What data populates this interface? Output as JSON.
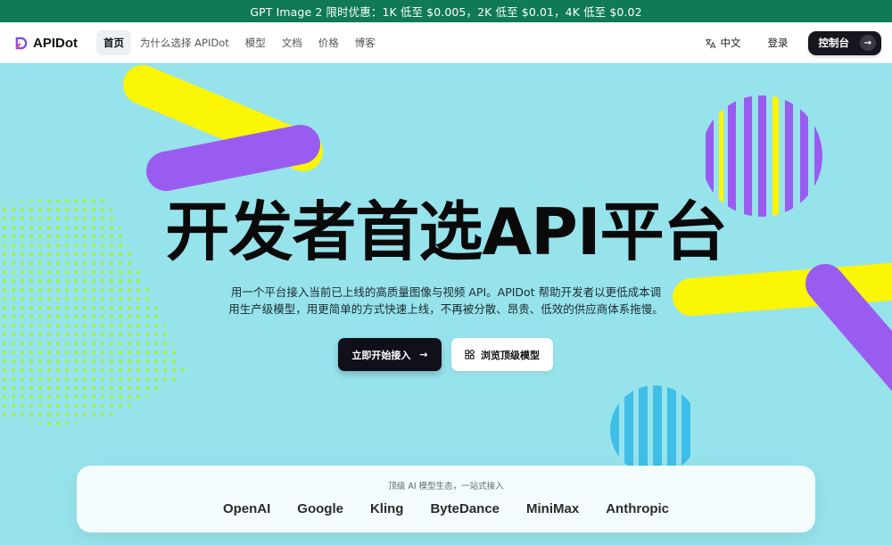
{
  "promo": {
    "text": "GPT Image 2 限时优惠：1K 低至 $0.005，2K 低至 $0.01，4K 低至 $0.02"
  },
  "nav": {
    "logo": "APIDot",
    "links": [
      "首页",
      "为什么选择 APIDot",
      "模型",
      "文档",
      "价格",
      "博客"
    ],
    "language": "中文",
    "login": "登录",
    "console": "控制台"
  },
  "hero": {
    "title": "开发者首选API平台",
    "desc_line1": "用一个平台接入当前已上线的高质量图像与视频 API。APIDot 帮助开发者以更低成本调",
    "desc_line2": "用生产级模型，用更简单的方式快速上线，不再被分散、昂贵、低效的供应商体系拖慢。",
    "primary_button": "立即开始接入",
    "secondary_button": "浏览顶级模型"
  },
  "partners": {
    "caption": "顶级 AI 模型生态，一站式接入",
    "names": [
      "OpenAI",
      "Google",
      "Kling",
      "ByteDance",
      "MiniMax",
      "Anthropic"
    ]
  },
  "colors": {
    "background": "#97e3ec",
    "promo_bar": "#0f7a54",
    "yellow": "#fbf506",
    "purple": "#9a5cf0",
    "lime": "#9ef23a",
    "blue": "#3fbfe8"
  }
}
